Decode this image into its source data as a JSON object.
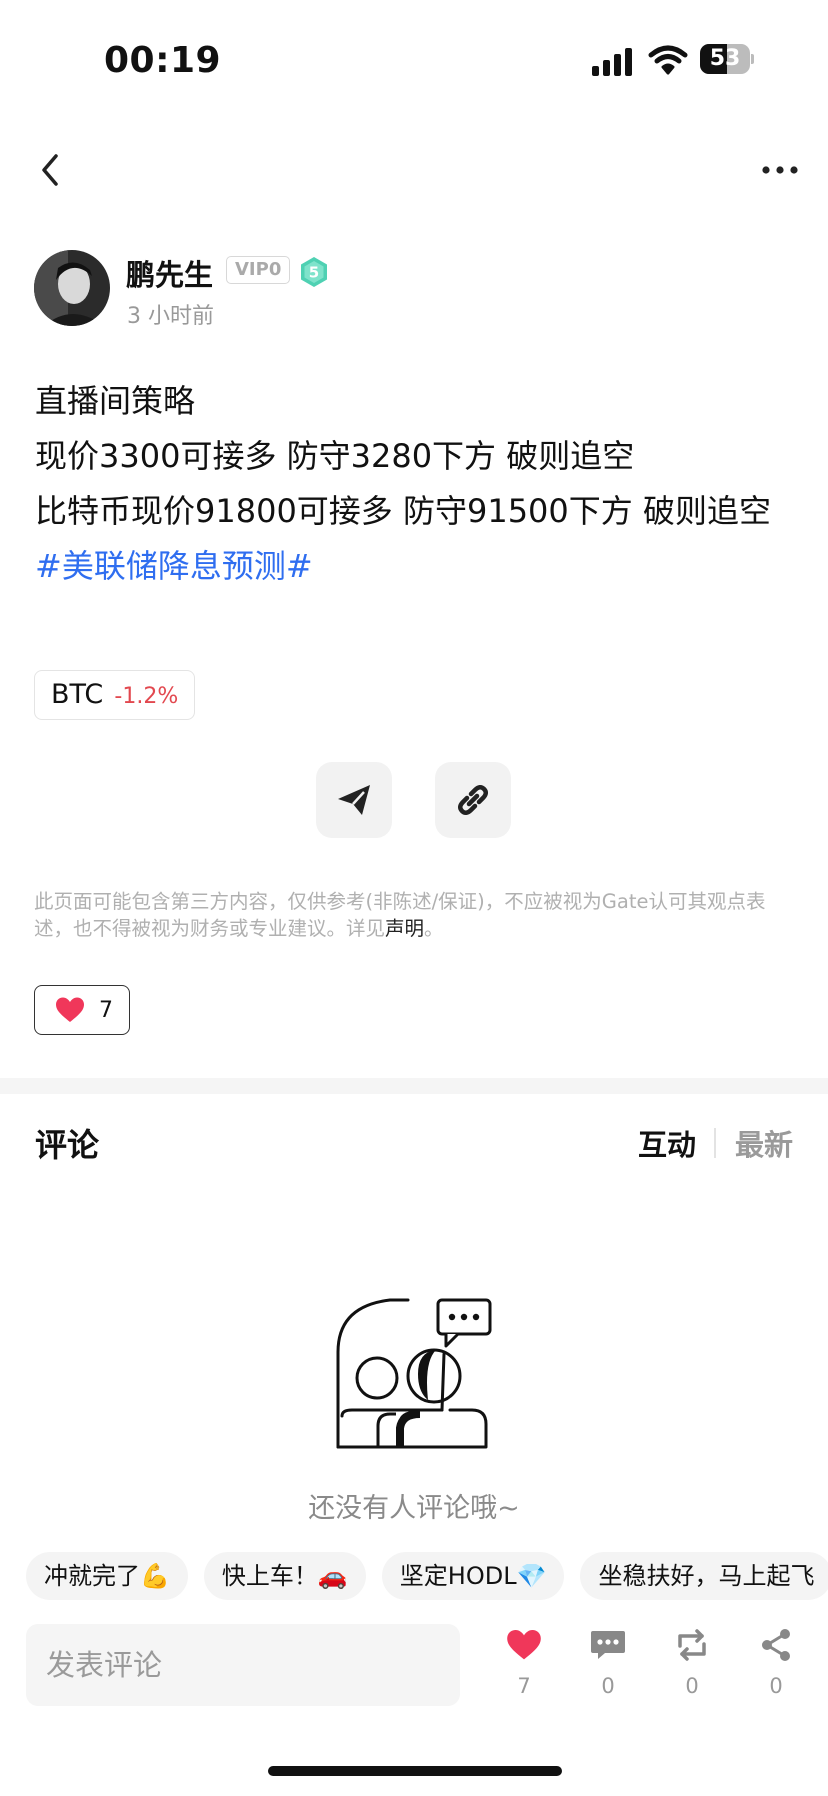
{
  "status_bar": {
    "time": "00:19",
    "battery": "53",
    "battery_level": 0.53
  },
  "author": {
    "name": "鹏先生",
    "vip": "VIP0",
    "level": "5",
    "posted": "3 小时前"
  },
  "post": {
    "lines": [
      "直播间策略",
      "现价3300可接多 防守3280下方 破则追空",
      "比特币现价91800可接多 防守91500下方 破则追空"
    ],
    "hashtag": "#美联储降息预测#",
    "coin": {
      "symbol": "BTC",
      "change": "-1.2%"
    }
  },
  "disclaimer": {
    "text": "此页面可能包含第三方内容，仅供参考(非陈述/保证)，不应被视为Gate认可其观点表述，也不得被视为财务或专业建议。详见",
    "link": "声明",
    "end": "。"
  },
  "likes": {
    "count": "7"
  },
  "comments": {
    "title": "评论",
    "tabs": [
      "互动",
      "最新"
    ],
    "empty_text": "还没有人评论哦~"
  },
  "quick_replies": [
    "冲就完了💪",
    "快上车！🚗",
    "坚定HODL💎",
    "坐稳扶好，马上起飞"
  ],
  "composer": {
    "placeholder": "发表评论"
  },
  "actions": {
    "like": "7",
    "comment": "0",
    "repost": "0",
    "share": "0"
  },
  "colors": {
    "hashtag": "#2f6ef0",
    "negative": "#e2484f",
    "like": "#f0375a",
    "level_badge": "#4fd1b3"
  },
  "icons": [
    "back-arrow-icon",
    "more-dots-icon",
    "send-icon",
    "link-icon",
    "heart-icon",
    "comment-icon",
    "repost-icon",
    "share-icon"
  ]
}
